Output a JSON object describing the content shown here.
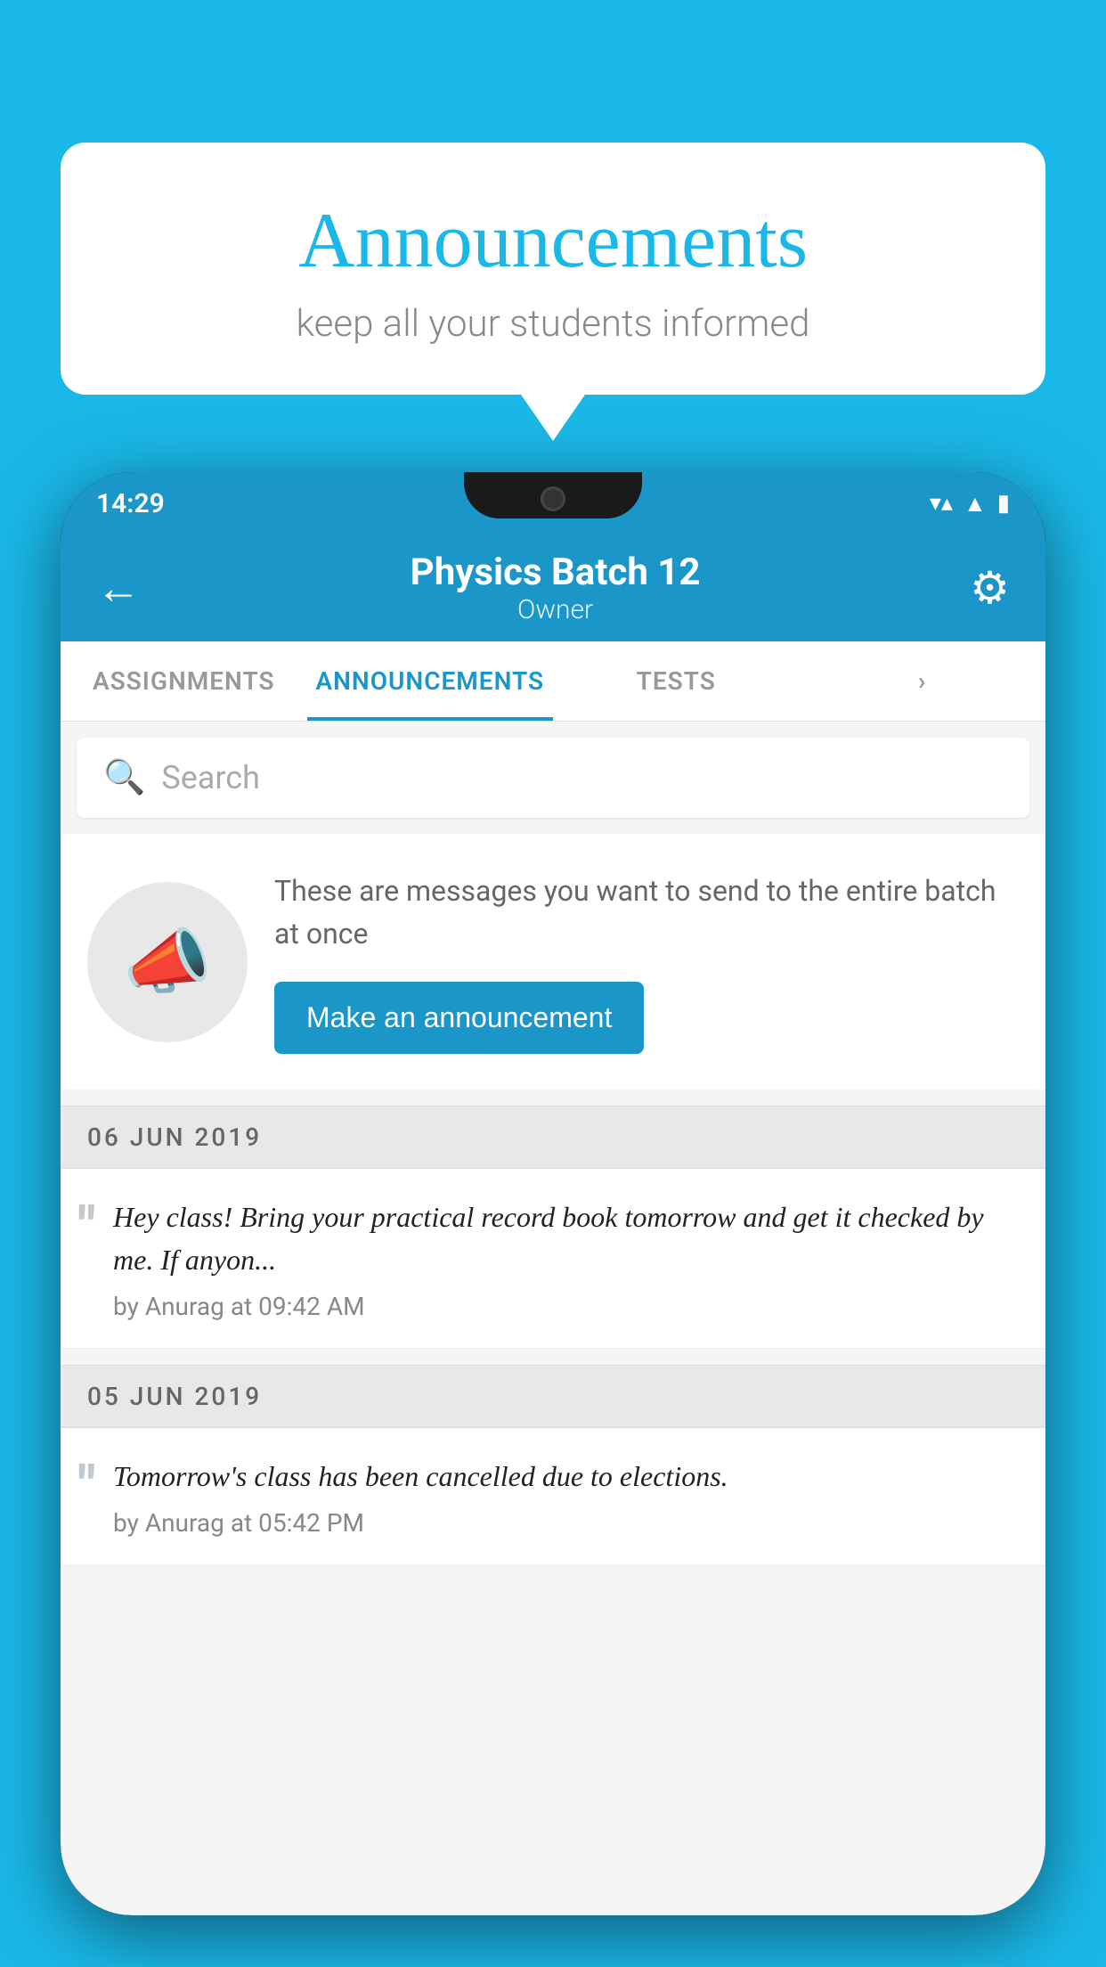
{
  "bubble": {
    "title": "Announcements",
    "subtitle": "keep all your students informed"
  },
  "statusBar": {
    "time": "14:29",
    "wifi": "▼▲",
    "signal": "▲",
    "battery": "▮"
  },
  "appBar": {
    "title": "Physics Batch 12",
    "subtitle": "Owner",
    "backLabel": "←",
    "gearLabel": "⚙"
  },
  "tabs": [
    {
      "label": "ASSIGNMENTS",
      "active": false
    },
    {
      "label": "ANNOUNCEMENTS",
      "active": true
    },
    {
      "label": "TESTS",
      "active": false
    },
    {
      "label": "···",
      "active": false
    }
  ],
  "search": {
    "placeholder": "Search"
  },
  "announcementIntro": {
    "description": "These are messages you want to send to the entire batch at once",
    "buttonLabel": "Make an announcement"
  },
  "announcements": [
    {
      "date": "06  JUN  2019",
      "messages": [
        {
          "text": "Hey class! Bring your practical record book tomorrow and get it checked by me. If anyon...",
          "author": "by Anurag at 09:42 AM"
        }
      ]
    },
    {
      "date": "05  JUN  2019",
      "messages": [
        {
          "text": "Tomorrow's class has been cancelled due to elections.",
          "author": "by Anurag at 05:42 PM"
        }
      ]
    }
  ],
  "colors": {
    "brand": "#1a96c8",
    "background": "#1ab8e8",
    "accent": "#1a96c8"
  }
}
